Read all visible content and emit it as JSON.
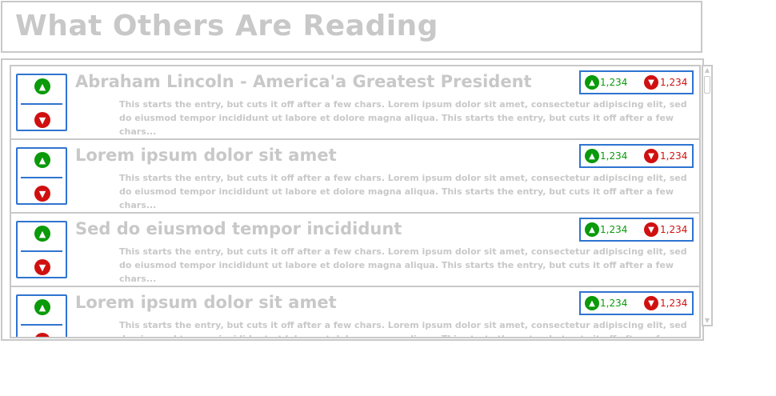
{
  "page": {
    "title": "What Others Are Reading"
  },
  "icons": {
    "vote_up": "chevron-up-circle-icon",
    "vote_down": "chevron-down-circle-icon",
    "scroll_up": "scroll-up-arrow-icon",
    "scroll_down": "scroll-down-arrow-icon"
  },
  "colors": {
    "accent_blue": "#2f74d0",
    "up_green": "#0a9a0a",
    "down_red": "#d01010",
    "muted_text": "#c8c8c8"
  },
  "entries": [
    {
      "title": "Abraham Lincoln - America'a Greatest President",
      "snippet": "This starts the entry, but cuts it off after a few chars. Lorem ipsum dolor sit amet, consectetur adipiscing elit, sed do eiusmod tempor incididunt ut labore et dolore magna aliqua. This starts the entry, but cuts it off after a few chars...",
      "up_count": "1,234",
      "down_count": "1,234"
    },
    {
      "title": "Lorem ipsum dolor sit amet",
      "snippet": "This starts the entry, but cuts it off after a few chars. Lorem ipsum dolor sit amet, consectetur adipiscing elit, sed do eiusmod tempor incididunt ut labore et dolore magna aliqua. This starts the entry, but cuts it off after a few chars...",
      "up_count": "1,234",
      "down_count": "1,234"
    },
    {
      "title": "Sed do eiusmod tempor incididunt",
      "snippet": "This starts the entry, but cuts it off after a few chars. Lorem ipsum dolor sit amet, consectetur adipiscing elit, sed do eiusmod tempor incididunt ut labore et dolore magna aliqua. This starts the entry, but cuts it off after a few chars...",
      "up_count": "1,234",
      "down_count": "1,234"
    },
    {
      "title": "Lorem ipsum dolor sit amet",
      "snippet": "This starts the entry, but cuts it off after a few chars. Lorem ipsum dolor sit amet, consectetur adipiscing elit, sed do eiusmod tempor incididunt ut labore et dolore magna aliqua. This starts the entry, but cuts it off after a few chars...",
      "up_count": "1,234",
      "down_count": "1,234"
    }
  ]
}
